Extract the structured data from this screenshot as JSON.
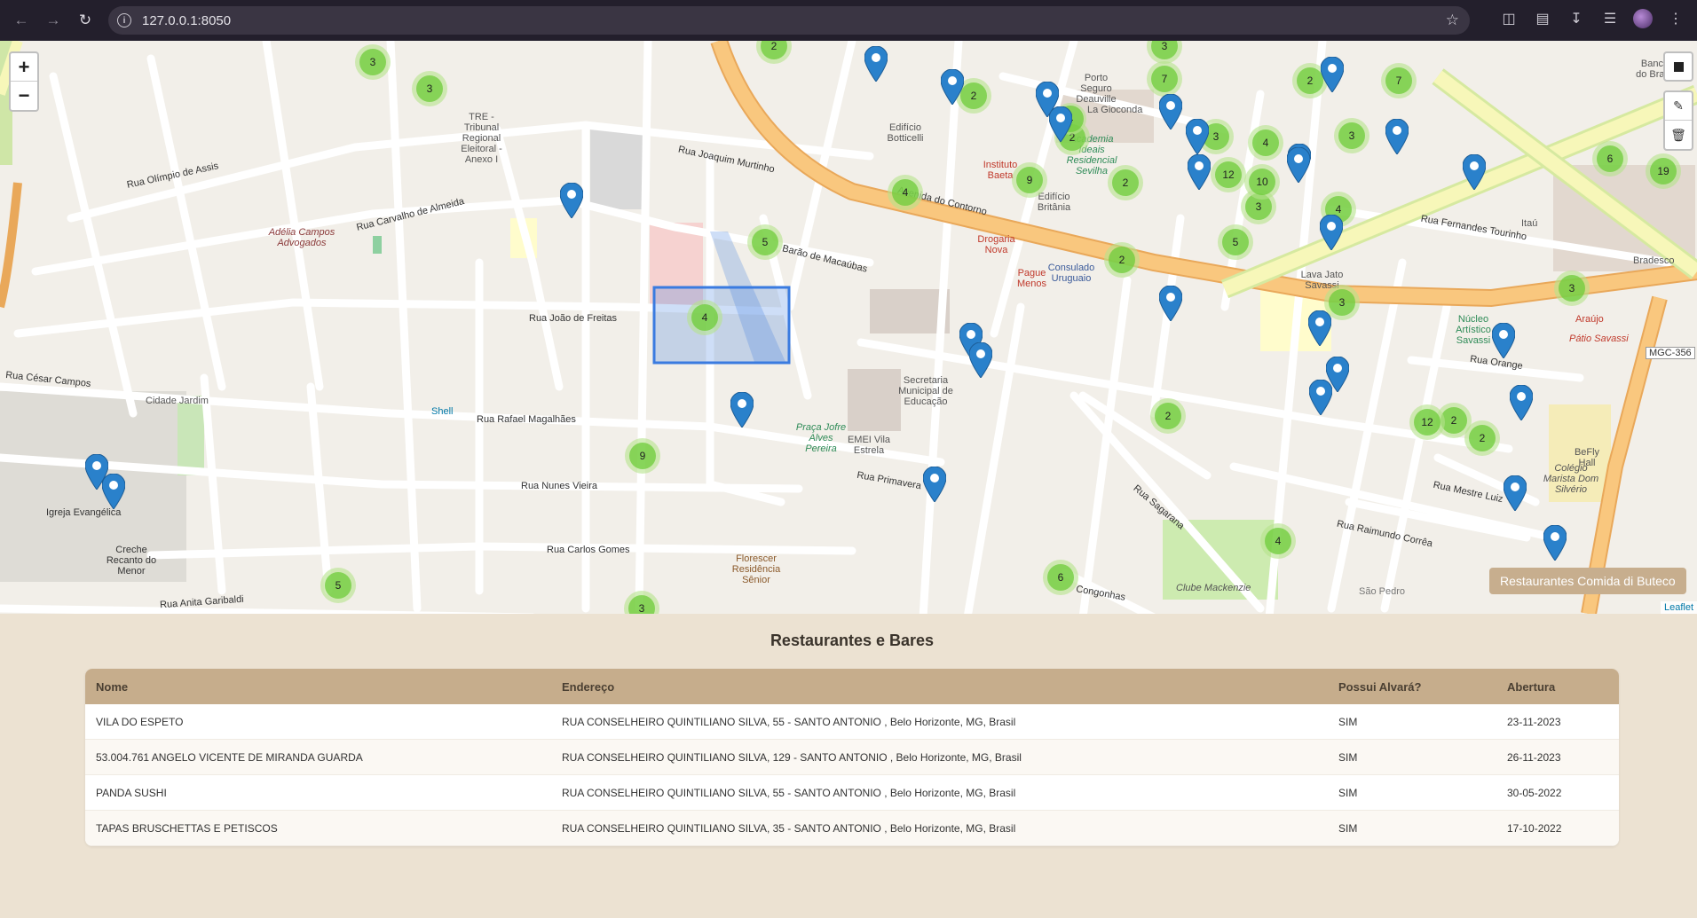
{
  "browser": {
    "url": "127.0.0.1:8050"
  },
  "map": {
    "zoom_in_label": "+",
    "zoom_out_label": "−",
    "legend": "Restaurantes Comida di Buteco",
    "attribution": "Leaflet",
    "streets": [
      {
        "text": "Rua Olímpio de Assis"
      },
      {
        "text": "Rua Carvalho de Almeida"
      },
      {
        "text": "Rua Joaquim Murtinho"
      },
      {
        "text": "Rua João de Freitas"
      },
      {
        "text": "Rua Rafael Magalhães"
      },
      {
        "text": "Rua Nunes Vieira"
      },
      {
        "text": "Rua Carlos Gomes"
      },
      {
        "text": "Rua Anita Garibaldi"
      },
      {
        "text": "Rua César Campos"
      },
      {
        "text": "Rua Primavera"
      },
      {
        "text": "Barão de Macaúbas"
      },
      {
        "text": "Avenida do Contorno"
      },
      {
        "text": "Rua Fernandes Tourinho"
      },
      {
        "text": "Rua Orange"
      },
      {
        "text": "Rua Mestre Luiz"
      },
      {
        "text": "Rua Raimundo Corrêa"
      },
      {
        "text": "Congonhas"
      },
      {
        "text": "Rua Sagarana"
      },
      {
        "text": "Cidade Jardim"
      },
      {
        "text": "Clube Mackenzie"
      },
      {
        "text": "São Pedro"
      },
      {
        "text": "Secretaria Municipal de Educação"
      },
      {
        "text": "EMEI Vila Estrela"
      },
      {
        "text": "Igreja Evangélica"
      },
      {
        "text": "Creche Recanto do Menor"
      },
      {
        "text": "Florescer Residência Sênior"
      },
      {
        "text": "Colégio Marista Dom Silvério"
      },
      {
        "text": "Shell"
      },
      {
        "text": "Praça Jofre Alves Pereira"
      },
      {
        "text": "Edifício Botticelli"
      },
      {
        "text": "Porto Seguro Deauville"
      },
      {
        "text": "La Gioconda"
      },
      {
        "text": "Núcleo Artístico Savassi"
      },
      {
        "text": "Pátio Savassi"
      },
      {
        "text": "MGC-356"
      },
      {
        "text": "Araújo"
      },
      {
        "text": "Lava Jato Savassi"
      },
      {
        "text": "Drogaria Nova"
      },
      {
        "text": "Pague Menos"
      },
      {
        "text": "Consulado Uruguaio"
      },
      {
        "text": "Instituto Baeta"
      },
      {
        "text": "TRE - Tribunal Regional Eleitoral - Anexo I"
      },
      {
        "text": "Adélia Campos Advogados"
      },
      {
        "text": "Edifício Britânia"
      },
      {
        "text": "Academia Ideais Residencial Sevilha"
      },
      {
        "text": "Banco do Brasil"
      },
      {
        "text": "Bradesco"
      },
      {
        "text": "Itaú"
      },
      {
        "text": "BeFly Hall"
      }
    ],
    "clusters": [
      "3",
      "3",
      "2",
      "2",
      "7",
      "3",
      "2",
      "2",
      "7",
      "4",
      "9",
      "2",
      "2",
      "3",
      "3",
      "4",
      "12",
      "10",
      "3",
      "4",
      "3",
      "6",
      "19",
      "5",
      "4",
      "5",
      "2",
      "3",
      "3",
      "9",
      "2",
      "12",
      "2",
      "2",
      "4",
      "6",
      "5",
      "3",
      "4"
    ]
  },
  "table": {
    "title": "Restaurantes e Bares",
    "headers": [
      "Nome",
      "Endereço",
      "Possui Alvará?",
      "Abertura"
    ],
    "rows": [
      [
        "VILA DO ESPETO",
        "RUA CONSELHEIRO QUINTILIANO SILVA, 55 - SANTO ANTONIO , Belo Horizonte, MG, Brasil",
        "SIM",
        "23-11-2023"
      ],
      [
        "53.004.761 ANGELO VICENTE DE MIRANDA GUARDA",
        "RUA CONSELHEIRO QUINTILIANO SILVA, 129 - SANTO ANTONIO , Belo Horizonte, MG, Brasil",
        "SIM",
        "26-11-2023"
      ],
      [
        "PANDA SUSHI",
        "RUA CONSELHEIRO QUINTILIANO SILVA, 55 - SANTO ANTONIO , Belo Horizonte, MG, Brasil",
        "SIM",
        "30-05-2022"
      ],
      [
        "TAPAS BRUSCHETTAS E PETISCOS",
        "RUA CONSELHEIRO QUINTILIANO SILVA, 35 - SANTO ANTONIO , Belo Horizonte, MG, Brasil",
        "SIM",
        "17-10-2022"
      ]
    ]
  },
  "colors": {
    "header_bg": "#c6ad8c",
    "page_bg": "#ece2d2",
    "marker": "#2a81cb",
    "cluster": "#6ecc39",
    "arterial": "#f9c77e",
    "selection": "#3a7be0"
  }
}
